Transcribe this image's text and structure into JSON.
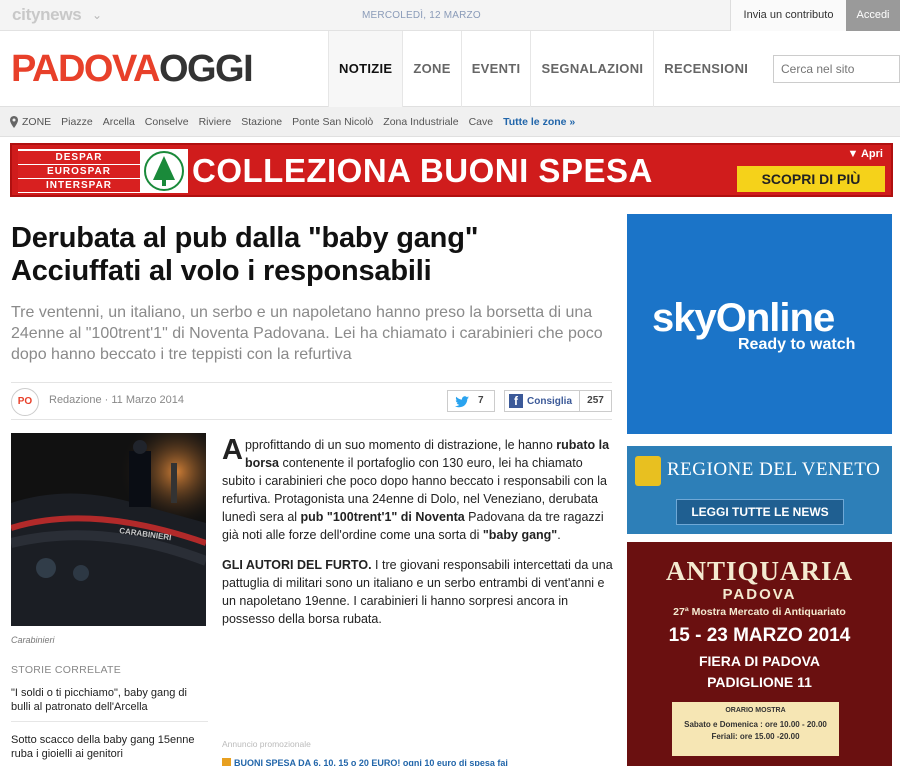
{
  "topbar": {
    "brand": "citynews",
    "date": "MERCOLEDÌ, 12 MARZO",
    "contribute_label": "Invia un contributo",
    "login_label": "Accedi"
  },
  "header": {
    "logo_part1": "PADOVA",
    "logo_part2": "OGGI",
    "nav": [
      "NOTIZIE",
      "ZONE",
      "EVENTI",
      "SEGNALAZIONI",
      "RECENSIONI"
    ],
    "search_placeholder": "Cerca nel sito"
  },
  "zones": {
    "label": "ZONE",
    "items": [
      "Piazze",
      "Arcella",
      "Conselve",
      "Riviere",
      "Stazione",
      "Ponte San Nicolò",
      "Zona Industriale",
      "Cave"
    ],
    "all_label": "Tutte le zone »"
  },
  "banner": {
    "brands": [
      "DESPAR",
      "EUROSPAR",
      "INTERSPAR"
    ],
    "headline": "COLLEZIONA BUONI SPESA",
    "open_label": "▼ Apri",
    "cta": "SCOPRI DI PIÙ"
  },
  "article": {
    "title_line1": "Derubata al pub dalla \"baby gang\"",
    "title_line2": "Acciuffati al volo i responsabili",
    "lede": "Tre ventenni, un italiano, un serbo e un napoletano hanno preso la borsetta di una 24enne al \"100trent'1\" di Noventa Padovana. Lei ha chiamato i carabinieri che poco dopo hanno beccato i tre teppisti con la refurtiva",
    "badge": "PO",
    "byline": "Redazione · 11 Marzo 2014",
    "twitter_count": "7",
    "facebook_label": "Consiglia",
    "facebook_count": "257",
    "photo_caption": "Carabinieri",
    "photo_text": "CARABINIERI",
    "p1_dropcap": "A",
    "p1_a": "pprofittando di un suo momento di distrazione, le hanno ",
    "p1_b": "rubato la borsa",
    "p1_c": " contenente il portafoglio con 130 euro, lei ha chiamato subito i carabinieri che poco dopo hanno beccato i responsabili con la refurtiva. Protagonista una 24enne di Dolo, nel Veneziano, derubata lunedì sera al ",
    "p1_d": "pub \"100trent'1\" di Noventa",
    "p1_e": " Padovana da tre ragazzi già noti alle forze dell'ordine come una sorta di ",
    "p1_f": "\"baby gang\"",
    "p1_g": ".",
    "p2_a": "GLI AUTORI DEL FURTO.",
    "p2_b": " I tre giovani responsabili intercettati da una pattuglia di militari sono un italiano e un serbo entrambi di vent'anni e un napoletano 19enne. I carabinieri li hanno sorpresi ancora in possesso della borsa rubata.",
    "annuncio": "Annuncio promozionale",
    "promo": "BUONI SPESA DA 6, 10, 15 o 20 EURO! ogni 10 euro di spesa fai"
  },
  "related": {
    "heading": "STORIE CORRELATE",
    "items": [
      "\"I soldi o ti picchiamo\", baby gang di bulli al patronato dell'Arcella",
      "Sotto scacco della baby gang 15enne ruba i gioielli ai genitori"
    ]
  },
  "ads": {
    "sky_logo": "skyOnline",
    "sky_sub": "Ready to watch",
    "veneto_title": "REGIONE DEL VENETO",
    "veneto_button": "LEGGI TUTTE LE NEWS",
    "antiq_title": "ANTIQUARIA",
    "antiq_city": "PADOVA",
    "antiq_sub": "27ª Mostra Mercato di Antiquariato",
    "antiq_dates": "15 - 23 MARZO 2014",
    "antiq_fiera": "FIERA DI PADOVA",
    "antiq_pad": "PADIGLIONE 11",
    "orario_h": "ORARIO MOSTRA",
    "orario_1": "Sabato e Domenica : ore 10.00 - 20.00",
    "orario_2": "Feriali: ore 15.00 -20.00"
  },
  "colors": {
    "brand_red": "#e8402a",
    "link_blue": "#2266aa",
    "sky_blue": "#1b74c8",
    "banner_red": "#d01c1c"
  }
}
